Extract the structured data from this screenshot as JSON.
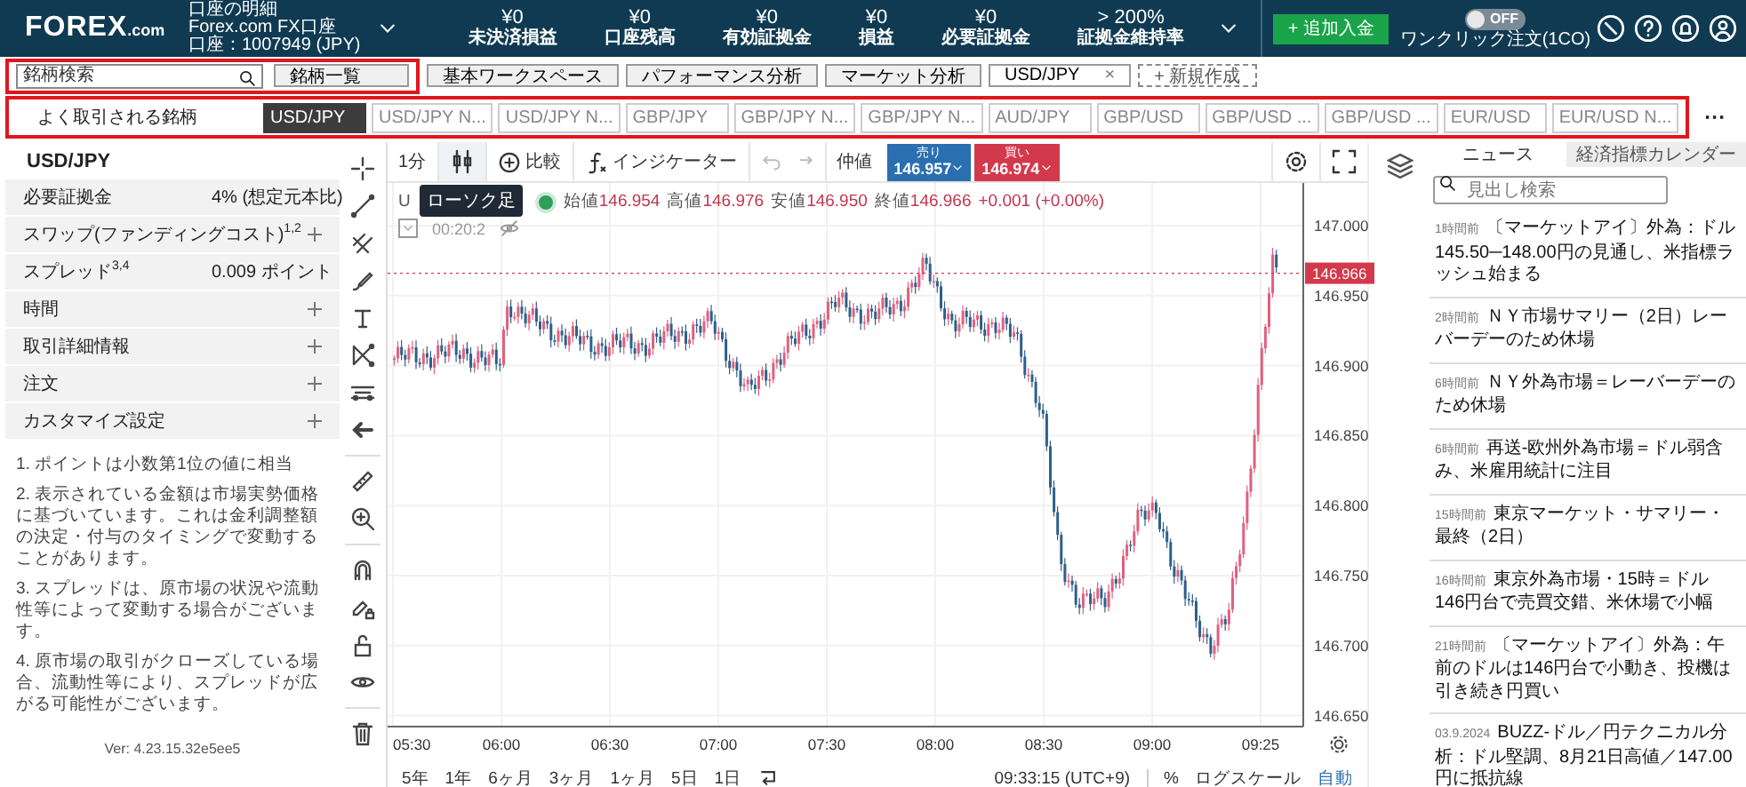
{
  "header": {
    "logo": {
      "name": "FOREX",
      "suffix": ".com"
    },
    "account": {
      "label": "口座の明細",
      "name": "Forex.com FX口座",
      "number": "口座：1007949 (JPY)"
    },
    "stats": [
      {
        "value": "¥0",
        "label": "未決済損益"
      },
      {
        "value": "¥0",
        "label": "口座残高"
      },
      {
        "value": "¥0",
        "label": "有効証拠金"
      },
      {
        "value": "¥0",
        "label": "損益"
      },
      {
        "value": "¥0",
        "label": "必要証拠金"
      },
      {
        "value": "> 200%",
        "label": "証拠金維持率"
      }
    ],
    "deposit_button": "+ 追加入金",
    "one_click": {
      "label": "ワンクリック注文(1CO)",
      "state_text": "OFF",
      "on": false
    }
  },
  "search": {
    "placeholder": "銘柄検索"
  },
  "instrument_list_button": "銘柄一覧",
  "workspace_tabs": [
    {
      "label": "基本ワークスペース",
      "selected": false
    },
    {
      "label": "パフォーマンス分析",
      "selected": false
    },
    {
      "label": "マーケット分析",
      "selected": false
    },
    {
      "label": "USD/JPY",
      "close": "×",
      "selected": true
    }
  ],
  "new_tab_button": "+ 新規作成",
  "favorites": {
    "label": "よく取引される銘柄",
    "more": "···",
    "items": [
      {
        "label": "USD/JPY",
        "selected": true
      },
      {
        "label": "USD/JPY N...",
        "selected": false
      },
      {
        "label": "USD/JPY N...",
        "selected": false
      },
      {
        "label": "GBP/JPY",
        "selected": false
      },
      {
        "label": "GBP/JPY N...",
        "selected": false
      },
      {
        "label": "GBP/JPY N...",
        "selected": false
      },
      {
        "label": "AUD/JPY",
        "selected": false
      },
      {
        "label": "GBP/USD",
        "selected": false
      },
      {
        "label": "GBP/USD ...",
        "selected": false
      },
      {
        "label": "GBP/USD ...",
        "selected": false
      },
      {
        "label": "EUR/USD",
        "selected": false
      },
      {
        "label": "EUR/USD N...",
        "selected": false
      }
    ]
  },
  "instrument_panel": {
    "title": "USD/JPY",
    "rows": [
      {
        "kind": "value",
        "label": "必要証拠金",
        "value": "4% (想定元本比)"
      },
      {
        "kind": "expandable",
        "label": "スワップ(ファンディングコスト)$^{1,2}$",
        "expanded": false
      },
      {
        "kind": "value",
        "label": "スプレッド$^{3,4}$",
        "value": "0.009 ポイント"
      },
      {
        "kind": "expandable",
        "label": "時間",
        "expanded": false
      },
      {
        "kind": "expandable",
        "label": "取引詳細情報",
        "expanded": false
      },
      {
        "kind": "expandable",
        "label": "注文",
        "expanded": false
      },
      {
        "kind": "expandable",
        "label": "カスタマイズ設定",
        "expanded": false
      }
    ],
    "notes": [
      "1. ポイントは小数第1位の値に相当",
      "2. 表示されている金額は市場実勢価格に基づいています。これは金利調整額の決定・付与のタイミングで変動することがあります。",
      "3. スプレッドは、原市場の状況や流動性等によって変動する場合がございます。",
      "4. 原市場の取引がクローズしている場合、流動性等により、スプレッドが広がる可能性がございます。"
    ],
    "version": "Ver: 4.23.15.32e5ee5"
  },
  "chart": {
    "toolbar": {
      "interval": "1分",
      "compare": "比較",
      "indicators": "インジケーター",
      "mid": "仲値",
      "sell": {
        "label": "売り",
        "price": "146.957"
      },
      "buy": {
        "label": "買い",
        "price": "146.974"
      }
    },
    "tooltip": "ローソク足",
    "legend": {
      "symbol": "U",
      "items": [
        {
          "label": "始値",
          "value": "146.954"
        },
        {
          "label": "高値",
          "value": "146.976"
        },
        {
          "label": "安値",
          "value": "146.950"
        },
        {
          "label": "終値",
          "value": "146.966"
        }
      ],
      "change": "+0.001 (+0.00%)",
      "countdown": "00:20:2"
    },
    "price_ticks": [
      "147.000",
      "146.950",
      "146.900",
      "146.850",
      "146.800",
      "146.750",
      "146.700",
      "146.650"
    ],
    "last_price": "146.966",
    "time_ticks": [
      "05:30",
      "06:00",
      "06:30",
      "07:00",
      "07:30",
      "08:00",
      "08:30",
      "09:00",
      "09:25"
    ],
    "ranges": [
      "5年",
      "1年",
      "6ヶ月",
      "3ヶ月",
      "1ヶ月",
      "5日",
      "1日"
    ],
    "clock": "09:33:15 (UTC+9)",
    "percent": "%",
    "log_scale": "ログスケール",
    "auto": "自動"
  },
  "news": {
    "tabs": [
      {
        "label": "ニュース",
        "selected": true
      },
      {
        "label": "経済指標カレンダー",
        "selected": false
      }
    ],
    "search": {
      "placeholder": "見出し検索"
    },
    "items": [
      {
        "time": "1時間前",
        "title": "〔マーケットアイ〕外為：ドル145.50─148.00円の見通し、米指標ラッシュ始まる"
      },
      {
        "time": "2時間前",
        "title": "ＮＹ市場サマリー（2日）レーバーデーのため休場"
      },
      {
        "time": "6時間前",
        "title": "ＮＹ外為市場＝レーバーデーのため休場"
      },
      {
        "time": "6時間前",
        "title": "再送-欧州外為市場＝ドル弱含み、米雇用統計に注目"
      },
      {
        "time": "15時間前",
        "title": "東京マーケット・サマリー・最終（2日）"
      },
      {
        "time": "16時間前",
        "title": "東京外為市場・15時＝ドル146円台で売買交錯、米休場で小幅"
      },
      {
        "time": "21時間前",
        "title": "〔マーケットアイ〕外為：午前のドルは146円台で小動き、投機は引き続き円買い"
      },
      {
        "time": "03.9.2024",
        "title": "BUZZ-ドル／円テクニカル分析：ドル堅調、8月21日高値／147.00円に抵抗線"
      }
    ]
  }
}
